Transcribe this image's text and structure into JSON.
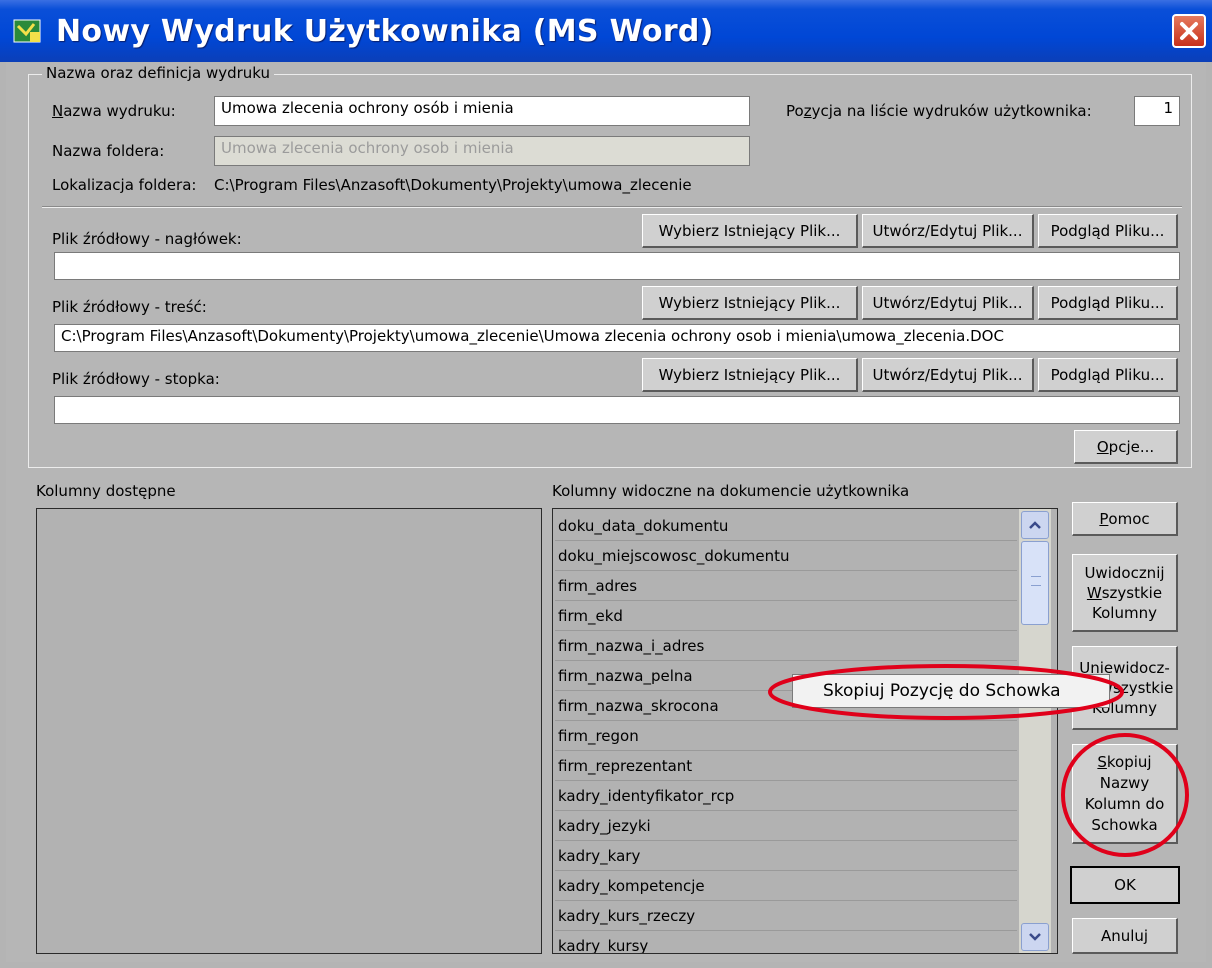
{
  "window": {
    "title": "Nowy Wydruk Użytkownika (MS Word)"
  },
  "definition": {
    "group_title": "Nazwa oraz definicja wydruku",
    "name_label": "Nazwa wydruku:",
    "name_value": "Umowa zlecenia ochrony osób i mienia",
    "folder_label": "Nazwa foldera:",
    "folder_value": "Umowa zlecenia ochrony osob i mienia",
    "location_label": "Lokalizacja foldera:",
    "location_value": "C:\\Program Files\\Anzasoft\\Dokumenty\\Projekty\\umowa_zlecenie",
    "position_label": "Pozycja na liście wydruków użytkownika:",
    "position_value": "1"
  },
  "files": {
    "choose_label": "Wybierz Istniejący Plik...",
    "edit_label": "Utwórz/Edytuj Plik...",
    "preview_label": "Podgląd Pliku...",
    "header_label": "Plik źródłowy - nagłówek:",
    "header_value": "",
    "content_label": "Plik źródłowy - treść:",
    "content_value": "C:\\Program Files\\Anzasoft\\Dokumenty\\Projekty\\umowa_zlecenie\\Umowa zlecenia ochrony osob i mienia\\umowa_zlecenia.DOC",
    "footer_label": "Plik źródłowy - stopka:",
    "footer_value": "",
    "options_label": "Opcje..."
  },
  "columns": {
    "available_label": "Kolumny dostępne",
    "visible_label": "Kolumny widoczne na dokumencie użytkownika",
    "visible_items": [
      "doku_data_dokumentu",
      "doku_miejscowosc_dokumentu",
      "firm_adres",
      "firm_ekd",
      "firm_nazwa_i_adres",
      "firm_nazwa_pelna",
      "firm_nazwa_skrocona",
      "firm_regon",
      "firm_reprezentant",
      "kadry_identyfikator_rcp",
      "kadry_jezyki",
      "kadry_kary",
      "kadry_kompetencje",
      "kadry_kurs_rzeczy",
      "kadry_kursy"
    ]
  },
  "side_buttons": {
    "help": "Pomoc",
    "show_all": [
      "Uwidocznij",
      "Wszystkie",
      "Kolumny"
    ],
    "hide_all": [
      "Uniewidocz-",
      "nij Wszystkie",
      "Kolumny"
    ],
    "copy_names": [
      "Skopiuj",
      "Nazwy",
      "Kolumn do",
      "Schowka"
    ],
    "ok": "OK",
    "cancel": "Anuluj"
  },
  "context_menu": {
    "item": "Skopiuj Pozycję do Schowka"
  },
  "colors": {
    "title_blue": "#0047d6",
    "highlight_red": "#e0001a",
    "close_red": "#d6442a"
  }
}
